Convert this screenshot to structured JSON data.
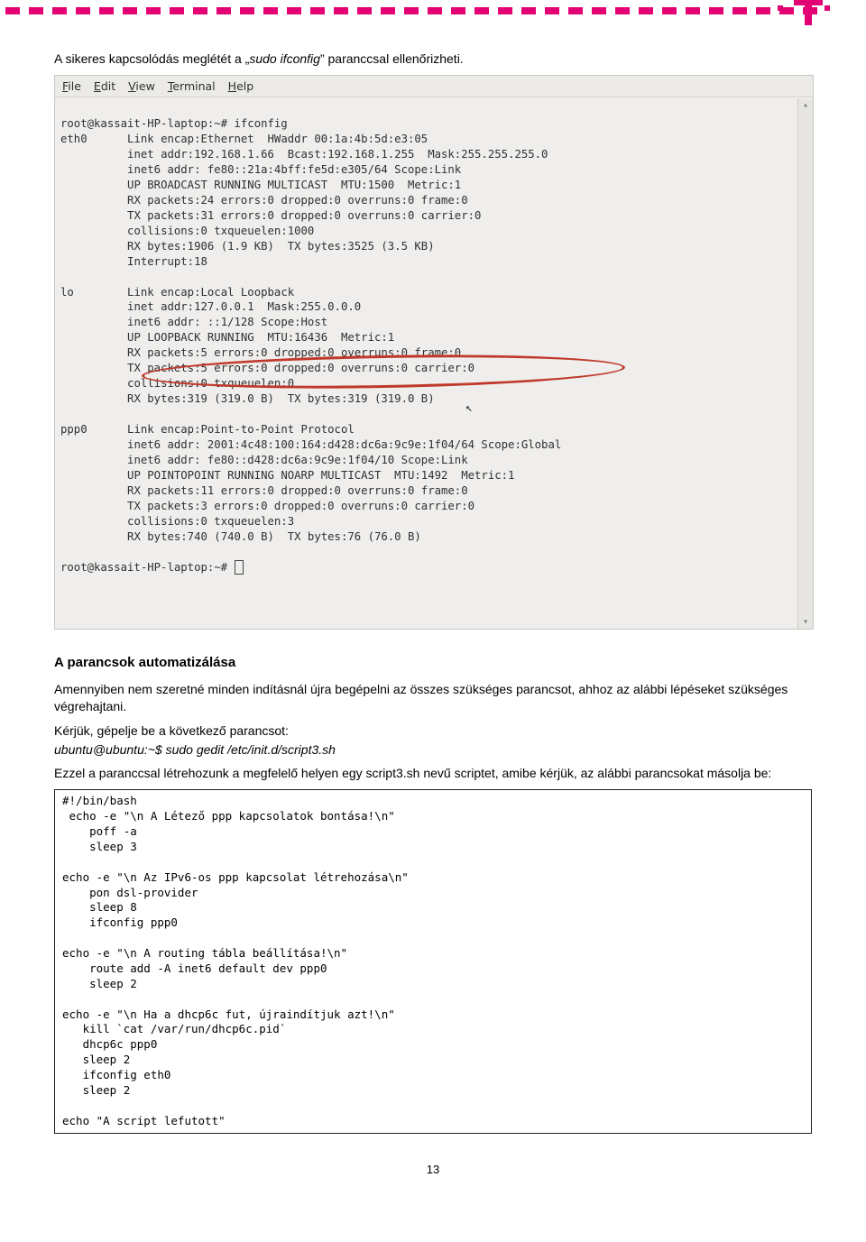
{
  "topbar": {
    "brand": "T"
  },
  "intro_text": {
    "before": "A sikeres kapcsolódás meglétét a „",
    "cmd": "sudo ifconfig",
    "after": "” paranccsal ellenőrizheti."
  },
  "menubar": {
    "file": "File",
    "edit": "Edit",
    "view": "View",
    "terminal": "Terminal",
    "help": "Help"
  },
  "terminal": {
    "prompt1": "root@kassait-HP-laptop:~# ifconfig",
    "eth0_label": "eth0",
    "eth0": [
      "Link encap:Ethernet  HWaddr 00:1a:4b:5d:e3:05",
      "inet addr:192.168.1.66  Bcast:192.168.1.255  Mask:255.255.255.0",
      "inet6 addr: fe80::21a:4bff:fe5d:e305/64 Scope:Link",
      "UP BROADCAST RUNNING MULTICAST  MTU:1500  Metric:1",
      "RX packets:24 errors:0 dropped:0 overruns:0 frame:0",
      "TX packets:31 errors:0 dropped:0 overruns:0 carrier:0",
      "collisions:0 txqueuelen:1000",
      "RX bytes:1906 (1.9 KB)  TX bytes:3525 (3.5 KB)",
      "Interrupt:18"
    ],
    "lo_label": "lo",
    "lo": [
      "Link encap:Local Loopback",
      "inet addr:127.0.0.1  Mask:255.0.0.0",
      "inet6 addr: ::1/128 Scope:Host",
      "UP LOOPBACK RUNNING  MTU:16436  Metric:1",
      "RX packets:5 errors:0 dropped:0 overruns:0 frame:0",
      "TX packets:5 errors:0 dropped:0 overruns:0 carrier:0",
      "collisions:0 txqueuelen:0",
      "RX bytes:319 (319.0 B)  TX bytes:319 (319.0 B)"
    ],
    "ppp0_label": "ppp0",
    "ppp0": [
      "Link encap:Point-to-Point Protocol",
      "inet6 addr: 2001:4c48:100:164:d428:dc6a:9c9e:1f04/64 Scope:Global",
      "inet6 addr: fe80::d428:dc6a:9c9e:1f04/10 Scope:Link",
      "UP POINTOPOINT RUNNING NOARP MULTICAST  MTU:1492  Metric:1",
      "RX packets:11 errors:0 dropped:0 overruns:0 frame:0",
      "TX packets:3 errors:0 dropped:0 overruns:0 carrier:0",
      "collisions:0 txqueuelen:3",
      "RX bytes:740 (740.0 B)  TX bytes:76 (76.0 B)"
    ],
    "prompt2": "root@kassait-HP-laptop:~# "
  },
  "section_heading": "A parancsok automatizálása",
  "auto_para1": "Amennyiben nem szeretné minden indításnál újra begépelni az összes szükséges parancsot, ahhoz az alábbi lépéseket szükséges végrehajtani.",
  "auto_para2a": "Kérjük, gépelje be a következő parancsot:",
  "auto_cmd": "ubuntu@ubuntu:~$ sudo gedit /etc/init.d/script3.sh",
  "auto_para3": "Ezzel a paranccsal létrehozunk a megfelelő helyen egy script3.sh nevű scriptet, amibe kérjük, az alábbi parancsokat másolja be:",
  "script": "#!/bin/bash\n echo -e \"\\n A Létező ppp kapcsolatok bontása!\\n\"\n    poff -a\n    sleep 3\n\necho -e \"\\n Az IPv6-os ppp kapcsolat létrehozása\\n\"\n    pon dsl-provider\n    sleep 8\n    ifconfig ppp0\n\necho -e \"\\n A routing tábla beállítása!\\n\"\n    route add -A inet6 default dev ppp0\n    sleep 2\n\necho -e \"\\n Ha a dhcp6c fut, újraindítjuk azt!\\n\"\n   kill `cat /var/run/dhcp6c.pid`\n   dhcp6c ppp0\n   sleep 2\n   ifconfig eth0\n   sleep 2\n\necho \"A script lefutott\"",
  "page_number": "13"
}
